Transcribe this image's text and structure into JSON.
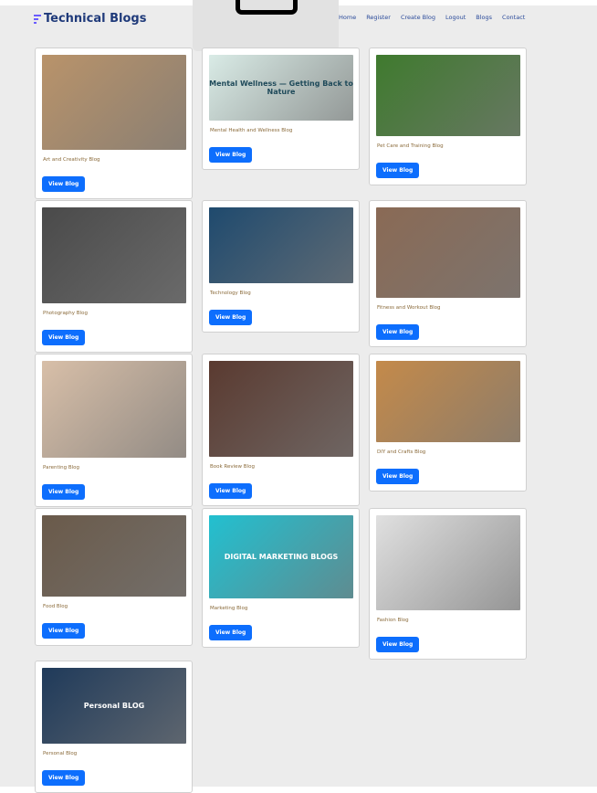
{
  "brand": {
    "title": "Technical Blogs"
  },
  "nav": [
    "Home",
    "Register",
    "Create Blog",
    "Logout",
    "Blogs",
    "Contact"
  ],
  "cards": [
    {
      "title": "Art and Creativity Blog",
      "button": "View Blog",
      "color": "#b9936a"
    },
    {
      "title": "Mental Health and Wellness Blog",
      "button": "View Blog",
      "color": "#d9ebe6",
      "img_text": "Mental Wellness — Getting Back to Nature"
    },
    {
      "title": "Pet Care and Training Blog",
      "button": "View Blog",
      "color": "#3f7a2e"
    },
    {
      "title": "Photography Blog",
      "button": "View Blog",
      "color": "#4a4a4a"
    },
    {
      "title": "Technology Blog",
      "button": "View Blog",
      "color": "#1f4a6e"
    },
    {
      "title": "Fitness and Workout Blog",
      "button": "View Blog",
      "color": "#8a6a55"
    },
    {
      "title": "Parenting Blog",
      "button": "View Blog",
      "color": "#d8bfa8"
    },
    {
      "title": "Book Review Blog",
      "button": "View Blog",
      "color": "#5a3a30"
    },
    {
      "title": "DIY and Crafts Blog",
      "button": "View Blog",
      "color": "#c48a4a"
    },
    {
      "title": "Food Blog",
      "button": "View Blog",
      "color": "#6a5a4a"
    },
    {
      "title": "Marketing Blog",
      "button": "View Blog",
      "color": "#22c0d0",
      "img_text": "DIGITAL MARKETING BLOGS"
    },
    {
      "title": "Fashion Blog",
      "button": "View Blog",
      "color": "#e0e0e0"
    },
    {
      "title": "Personal Blog",
      "button": "View Blog",
      "color": "#1f3a5a",
      "img_text": "Personal BLOG"
    }
  ]
}
